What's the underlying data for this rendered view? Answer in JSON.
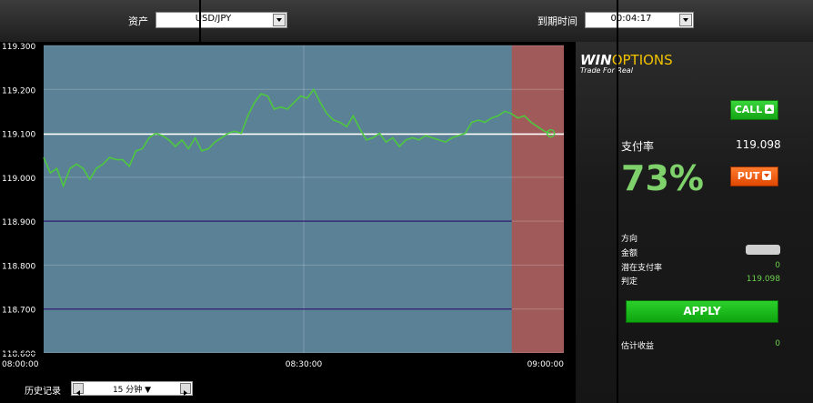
{
  "top_bar": {
    "asset_label": "资产",
    "asset_value": "USD/JPY",
    "expiry_label": "到期时间",
    "expiry_value": "00:04:17"
  },
  "chart_data": {
    "type": "line",
    "ylim": [
      118.6,
      119.3
    ],
    "y_ticks": [
      "119.300",
      "119.200",
      "119.100",
      "119.000",
      "118.900",
      "118.800",
      "118.700",
      "118.600"
    ],
    "x_ticks": [
      "08:00:00",
      "08:30:00",
      "09:00:00"
    ],
    "current_price": 119.098,
    "reference_lines": [
      118.9,
      118.7
    ],
    "expiry_zone_start": "08:54:00",
    "series": [
      {
        "values": [
          [
            0,
            119.045
          ],
          [
            1,
            119.01
          ],
          [
            2,
            119.02
          ],
          [
            3,
            118.98
          ],
          [
            4,
            119.02
          ],
          [
            5,
            119.03
          ],
          [
            6,
            119.02
          ],
          [
            7,
            118.995
          ],
          [
            8,
            119.02
          ],
          [
            9,
            119.03
          ],
          [
            10,
            119.045
          ],
          [
            11,
            119.04
          ],
          [
            12,
            119.04
          ],
          [
            13,
            119.025
          ],
          [
            14,
            119.06
          ],
          [
            15,
            119.065
          ],
          [
            16,
            119.09
          ],
          [
            17,
            119.1
          ],
          [
            18,
            119.095
          ],
          [
            19,
            119.085
          ],
          [
            20,
            119.07
          ],
          [
            21,
            119.085
          ],
          [
            22,
            119.065
          ],
          [
            23,
            119.09
          ],
          [
            24,
            119.06
          ],
          [
            25,
            119.065
          ],
          [
            26,
            119.08
          ],
          [
            27,
            119.09
          ],
          [
            28,
            119.1
          ],
          [
            29,
            119.105
          ],
          [
            30,
            119.1
          ],
          [
            31,
            119.14
          ],
          [
            32,
            119.17
          ],
          [
            33,
            119.19
          ],
          [
            34,
            119.185
          ],
          [
            35,
            119.155
          ],
          [
            36,
            119.16
          ],
          [
            37,
            119.155
          ],
          [
            38,
            119.17
          ],
          [
            39,
            119.185
          ],
          [
            40,
            119.18
          ],
          [
            41,
            119.2
          ],
          [
            42,
            119.17
          ],
          [
            43,
            119.145
          ],
          [
            44,
            119.13
          ],
          [
            45,
            119.125
          ],
          [
            46,
            119.115
          ],
          [
            47,
            119.14
          ],
          [
            48,
            119.11
          ],
          [
            49,
            119.085
          ],
          [
            50,
            119.09
          ],
          [
            51,
            119.1
          ],
          [
            52,
            119.08
          ],
          [
            53,
            119.09
          ],
          [
            54,
            119.07
          ],
          [
            55,
            119.085
          ],
          [
            56,
            119.09
          ],
          [
            57,
            119.085
          ],
          [
            58,
            119.095
          ],
          [
            59,
            119.09
          ],
          [
            60,
            119.085
          ],
          [
            61,
            119.08
          ],
          [
            62,
            119.09
          ],
          [
            63,
            119.095
          ],
          [
            64,
            119.1
          ],
          [
            65,
            119.125
          ],
          [
            66,
            119.13
          ],
          [
            67,
            119.125
          ],
          [
            68,
            119.135
          ],
          [
            69,
            119.14
          ],
          [
            70,
            119.15
          ],
          [
            71,
            119.145
          ],
          [
            72,
            119.135
          ],
          [
            73,
            119.14
          ],
          [
            74,
            119.125
          ],
          [
            75,
            119.115
          ],
          [
            76,
            119.105
          ],
          [
            77,
            119.1
          ]
        ]
      }
    ]
  },
  "bottom_bar": {
    "history_label": "历史记录",
    "interval_value": "15 分钟"
  },
  "panel": {
    "logo_win": "WIN",
    "logo_options": "OPTIONS",
    "tagline": "Trade For Real",
    "call_label": "CALL",
    "payout_label": "支付率",
    "price_value": "119.098",
    "payout_percent": "73%",
    "put_label": "PUT",
    "direction_label": "方向",
    "amount_label": "金额",
    "potential_label": "潜在支付率",
    "potential_value": "0",
    "strike_label": "判定",
    "strike_value": "119.098",
    "apply_label": "APPLY",
    "estimated_label": "估计收益",
    "estimated_value": "0"
  },
  "colors": {
    "chart_bg": "#5a8196",
    "expiry_zone": "#a05a5a",
    "price_line": "#4ec83e",
    "ref_line": "#2e1a6e",
    "payout_green": "#7fd16b",
    "call_green": "#22bb22",
    "put_orange": "#f06010"
  }
}
